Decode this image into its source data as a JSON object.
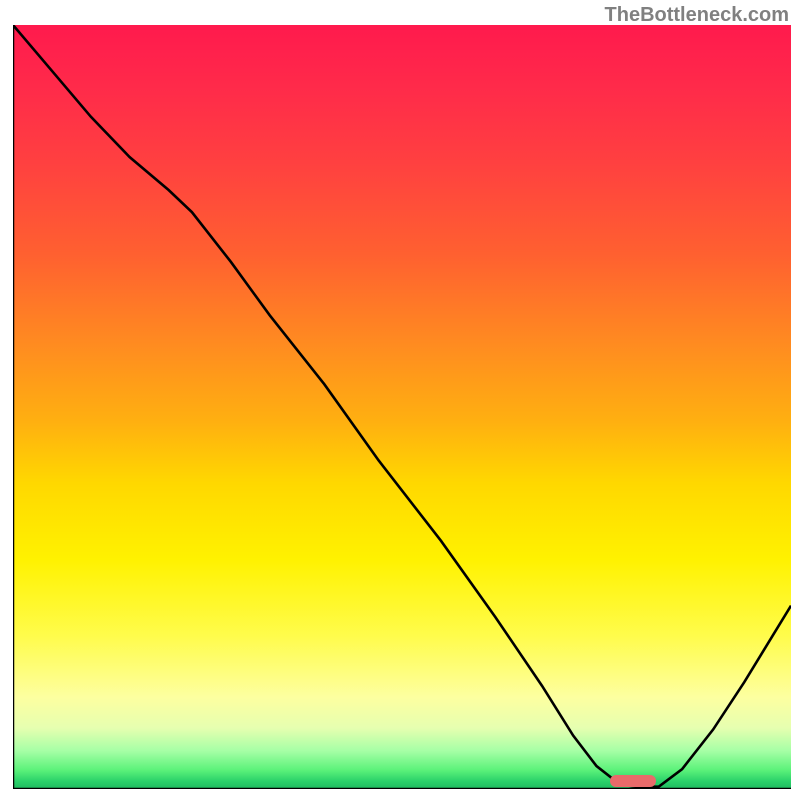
{
  "attribution": "TheBottleneck.com",
  "chart_data": {
    "type": "line",
    "title": "",
    "xlabel": "",
    "ylabel": "",
    "x": [
      0.0,
      0.05,
      0.1,
      0.15,
      0.2,
      0.23,
      0.28,
      0.33,
      0.4,
      0.47,
      0.55,
      0.62,
      0.68,
      0.72,
      0.75,
      0.78,
      0.8,
      0.83,
      0.86,
      0.9,
      0.94,
      1.0
    ],
    "values": [
      1.0,
      0.94,
      0.88,
      0.827,
      0.784,
      0.755,
      0.69,
      0.62,
      0.53,
      0.43,
      0.325,
      0.225,
      0.135,
      0.07,
      0.03,
      0.006,
      0.003,
      0.003,
      0.026,
      0.078,
      0.14,
      0.24
    ],
    "xlim": [
      0,
      1
    ],
    "ylim": [
      0,
      1
    ],
    "curve_note": "Black line descending steeply from upper-left, inflecting, reaching minimum plateau around x=0.78-0.83, then rising to right edge. Background gradient encodes bottleneck severity (red=high, green=low).",
    "minimum_marker": {
      "x_center": 0.805,
      "width": 0.06,
      "color": "#e96a6a"
    },
    "gradient": [
      {
        "color": "#ff1a4d",
        "stop": 0.0
      },
      {
        "color": "#ff8c20",
        "stop": 0.42
      },
      {
        "color": "#fff200",
        "stop": 0.7
      },
      {
        "color": "#5cf27a",
        "stop": 0.975
      },
      {
        "color": "#1fba60",
        "stop": 1.0
      }
    ]
  }
}
